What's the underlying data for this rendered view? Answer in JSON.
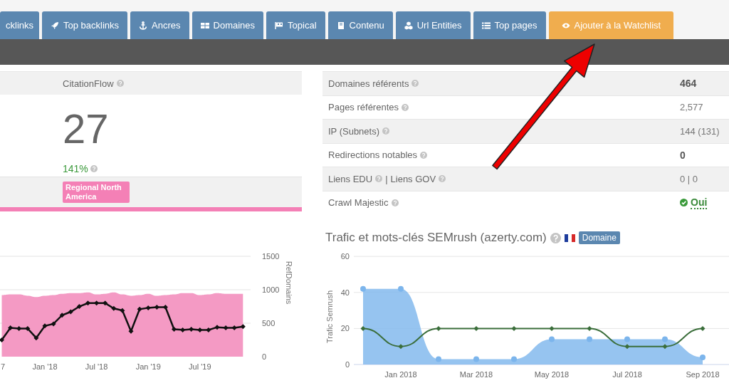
{
  "tabs": [
    {
      "label": "cklinks",
      "kind": "tab"
    },
    {
      "label": "Top backlinks",
      "kind": "tab"
    },
    {
      "label": "Ancres",
      "kind": "tab"
    },
    {
      "label": "Domaines",
      "kind": "tab"
    },
    {
      "label": "Topical",
      "kind": "tab"
    },
    {
      "label": "Contenu",
      "kind": "tab"
    },
    {
      "label": "Url Entities",
      "kind": "tab"
    },
    {
      "label": "Top pages",
      "kind": "tab"
    },
    {
      "label": "Ajouter à la Watchlist",
      "kind": "action"
    }
  ],
  "citation": {
    "header": {
      "text": "CitationFlow",
      "help": true
    },
    "score": "27",
    "change": {
      "text": "141%",
      "help": true
    },
    "topic": "Regional North America",
    "chart_data": {
      "type": "area",
      "ylabel": "RefDomains",
      "yticks": [
        0,
        500,
        1000,
        1500
      ],
      "ylim": [
        0,
        1500
      ],
      "categories": [
        "7",
        null,
        null,
        null,
        null,
        "Jan '18",
        null,
        null,
        null,
        null,
        null,
        "Jul '18",
        null,
        null,
        null,
        null,
        null,
        "Jan '19",
        null,
        null,
        null,
        null,
        null,
        "Jul '19",
        null,
        null,
        null,
        null,
        null
      ],
      "series": [
        {
          "type": "area",
          "color": "#f49ac4",
          "values": [
            920,
            930,
            930,
            910,
            890,
            910,
            920,
            940,
            950,
            950,
            960,
            930,
            940,
            960,
            930,
            910,
            920,
            940,
            910,
            920,
            930,
            950,
            950,
            920,
            930,
            950,
            940,
            940,
            940
          ]
        },
        {
          "type": "line",
          "color": "#111111",
          "marker": true,
          "values": [
            250,
            430,
            420,
            420,
            280,
            460,
            490,
            620,
            670,
            750,
            800,
            800,
            800,
            720,
            690,
            380,
            710,
            730,
            740,
            740,
            410,
            400,
            410,
            400,
            400,
            440,
            430,
            430,
            450
          ]
        }
      ]
    }
  },
  "metrics": [
    {
      "label": [
        {
          "text": "Domaines référents",
          "help": true
        }
      ],
      "value": "464",
      "bold": true
    },
    {
      "label": [
        {
          "text": "Pages référentes",
          "help": true
        }
      ],
      "value": "2,577",
      "bold": false
    },
    {
      "label": [
        {
          "text": "IP (Subnets)",
          "help": true
        }
      ],
      "value": "144 (131)",
      "bold": false
    },
    {
      "label": [
        {
          "text": "Redirections notables",
          "help": true
        }
      ],
      "value": "0",
      "bold": true
    },
    {
      "label": [
        {
          "text": "Liens EDU",
          "help": true
        },
        {
          "text": "|",
          "help": false
        },
        {
          "text": "Liens GOV",
          "help": true
        }
      ],
      "value": "0 | 0",
      "bold": false
    },
    {
      "label": [
        {
          "text": "Crawl Majestic",
          "help": true
        }
      ],
      "value": "Oui",
      "bold": true,
      "ok": true
    }
  ],
  "semrush": {
    "title": "Trafic et mots-clés SEMrush (azerty.com)",
    "help": true,
    "flag": true,
    "badge": "Domaine",
    "chart_data": {
      "type": "area",
      "ylabel": "Trafic Semrush",
      "yticks": [
        0,
        20,
        40,
        60
      ],
      "ylim": [
        0,
        60
      ],
      "categories": [
        null,
        "Jan 2018",
        null,
        "Mar 2018",
        null,
        "May 2018",
        null,
        "Jul 2018",
        null,
        "Sep 2018"
      ],
      "series": [
        {
          "type": "area",
          "color": "#7cb5ec",
          "marker": true,
          "values": [
            42,
            42,
            3,
            3,
            3,
            14,
            14,
            14,
            14,
            4
          ]
        },
        {
          "type": "line",
          "color": "#3b6e3b",
          "marker": true,
          "values": [
            20,
            10,
            20,
            20,
            20,
            20,
            20,
            10,
            10,
            20
          ]
        }
      ]
    }
  }
}
